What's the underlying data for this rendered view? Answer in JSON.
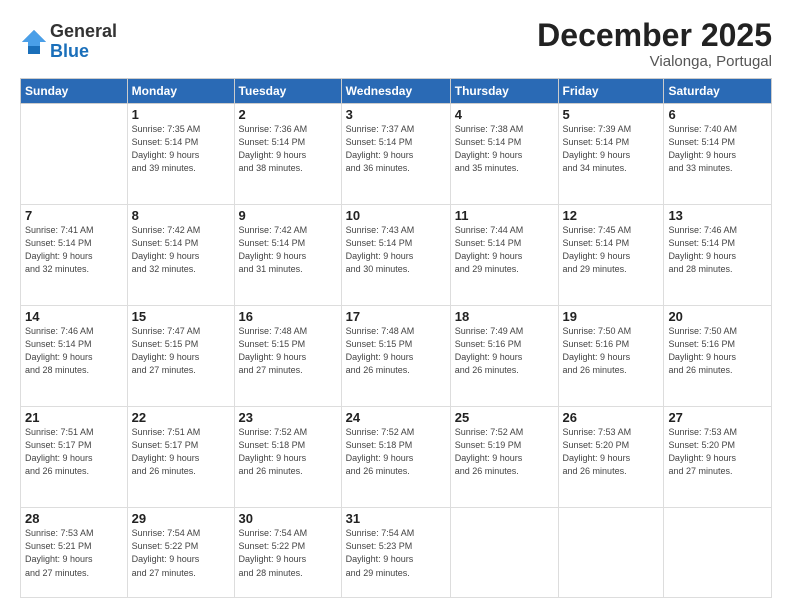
{
  "logo": {
    "general": "General",
    "blue": "Blue"
  },
  "header": {
    "month": "December 2025",
    "location": "Vialonga, Portugal"
  },
  "weekdays": [
    "Sunday",
    "Monday",
    "Tuesday",
    "Wednesday",
    "Thursday",
    "Friday",
    "Saturday"
  ],
  "weeks": [
    [
      {
        "day": "",
        "info": ""
      },
      {
        "day": "1",
        "info": "Sunrise: 7:35 AM\nSunset: 5:14 PM\nDaylight: 9 hours\nand 39 minutes."
      },
      {
        "day": "2",
        "info": "Sunrise: 7:36 AM\nSunset: 5:14 PM\nDaylight: 9 hours\nand 38 minutes."
      },
      {
        "day": "3",
        "info": "Sunrise: 7:37 AM\nSunset: 5:14 PM\nDaylight: 9 hours\nand 36 minutes."
      },
      {
        "day": "4",
        "info": "Sunrise: 7:38 AM\nSunset: 5:14 PM\nDaylight: 9 hours\nand 35 minutes."
      },
      {
        "day": "5",
        "info": "Sunrise: 7:39 AM\nSunset: 5:14 PM\nDaylight: 9 hours\nand 34 minutes."
      },
      {
        "day": "6",
        "info": "Sunrise: 7:40 AM\nSunset: 5:14 PM\nDaylight: 9 hours\nand 33 minutes."
      }
    ],
    [
      {
        "day": "7",
        "info": "Sunrise: 7:41 AM\nSunset: 5:14 PM\nDaylight: 9 hours\nand 32 minutes."
      },
      {
        "day": "8",
        "info": "Sunrise: 7:42 AM\nSunset: 5:14 PM\nDaylight: 9 hours\nand 32 minutes."
      },
      {
        "day": "9",
        "info": "Sunrise: 7:42 AM\nSunset: 5:14 PM\nDaylight: 9 hours\nand 31 minutes."
      },
      {
        "day": "10",
        "info": "Sunrise: 7:43 AM\nSunset: 5:14 PM\nDaylight: 9 hours\nand 30 minutes."
      },
      {
        "day": "11",
        "info": "Sunrise: 7:44 AM\nSunset: 5:14 PM\nDaylight: 9 hours\nand 29 minutes."
      },
      {
        "day": "12",
        "info": "Sunrise: 7:45 AM\nSunset: 5:14 PM\nDaylight: 9 hours\nand 29 minutes."
      },
      {
        "day": "13",
        "info": "Sunrise: 7:46 AM\nSunset: 5:14 PM\nDaylight: 9 hours\nand 28 minutes."
      }
    ],
    [
      {
        "day": "14",
        "info": "Sunrise: 7:46 AM\nSunset: 5:14 PM\nDaylight: 9 hours\nand 28 minutes."
      },
      {
        "day": "15",
        "info": "Sunrise: 7:47 AM\nSunset: 5:15 PM\nDaylight: 9 hours\nand 27 minutes."
      },
      {
        "day": "16",
        "info": "Sunrise: 7:48 AM\nSunset: 5:15 PM\nDaylight: 9 hours\nand 27 minutes."
      },
      {
        "day": "17",
        "info": "Sunrise: 7:48 AM\nSunset: 5:15 PM\nDaylight: 9 hours\nand 26 minutes."
      },
      {
        "day": "18",
        "info": "Sunrise: 7:49 AM\nSunset: 5:16 PM\nDaylight: 9 hours\nand 26 minutes."
      },
      {
        "day": "19",
        "info": "Sunrise: 7:50 AM\nSunset: 5:16 PM\nDaylight: 9 hours\nand 26 minutes."
      },
      {
        "day": "20",
        "info": "Sunrise: 7:50 AM\nSunset: 5:16 PM\nDaylight: 9 hours\nand 26 minutes."
      }
    ],
    [
      {
        "day": "21",
        "info": "Sunrise: 7:51 AM\nSunset: 5:17 PM\nDaylight: 9 hours\nand 26 minutes."
      },
      {
        "day": "22",
        "info": "Sunrise: 7:51 AM\nSunset: 5:17 PM\nDaylight: 9 hours\nand 26 minutes."
      },
      {
        "day": "23",
        "info": "Sunrise: 7:52 AM\nSunset: 5:18 PM\nDaylight: 9 hours\nand 26 minutes."
      },
      {
        "day": "24",
        "info": "Sunrise: 7:52 AM\nSunset: 5:18 PM\nDaylight: 9 hours\nand 26 minutes."
      },
      {
        "day": "25",
        "info": "Sunrise: 7:52 AM\nSunset: 5:19 PM\nDaylight: 9 hours\nand 26 minutes."
      },
      {
        "day": "26",
        "info": "Sunrise: 7:53 AM\nSunset: 5:20 PM\nDaylight: 9 hours\nand 26 minutes."
      },
      {
        "day": "27",
        "info": "Sunrise: 7:53 AM\nSunset: 5:20 PM\nDaylight: 9 hours\nand 27 minutes."
      }
    ],
    [
      {
        "day": "28",
        "info": "Sunrise: 7:53 AM\nSunset: 5:21 PM\nDaylight: 9 hours\nand 27 minutes."
      },
      {
        "day": "29",
        "info": "Sunrise: 7:54 AM\nSunset: 5:22 PM\nDaylight: 9 hours\nand 27 minutes."
      },
      {
        "day": "30",
        "info": "Sunrise: 7:54 AM\nSunset: 5:22 PM\nDaylight: 9 hours\nand 28 minutes."
      },
      {
        "day": "31",
        "info": "Sunrise: 7:54 AM\nSunset: 5:23 PM\nDaylight: 9 hours\nand 29 minutes."
      },
      {
        "day": "",
        "info": ""
      },
      {
        "day": "",
        "info": ""
      },
      {
        "day": "",
        "info": ""
      }
    ]
  ]
}
